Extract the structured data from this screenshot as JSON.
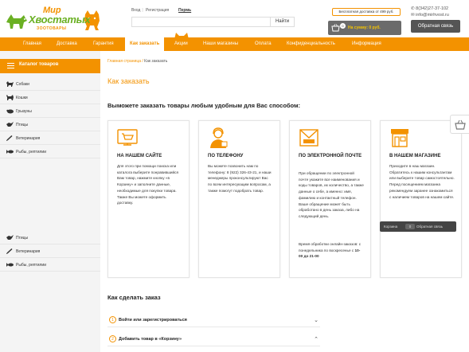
{
  "header": {
    "logo_line1": "Мир",
    "logo_line2": "Хвостатых",
    "logo_sub": "ЗООТОВАРЫ",
    "login_label": "Вход",
    "register_label": "Регистрация",
    "lang_label": "Пермь",
    "search_placeholder": "",
    "search_button": "Найти",
    "delivery_note": "Бесплатная доставка от 499 руб.",
    "cart_count": "0",
    "cart_sum": "На сумму: 0 руб.",
    "phone": "8(342)27-37-102",
    "email": "info@mirhvost.ru",
    "callback_button": "Обратная связь"
  },
  "nav": {
    "items": [
      "Главная",
      "Доставка",
      "Гарантия",
      "Как заказать",
      "Акции",
      "Наши магазины",
      "Оплата",
      "Конфиденциальность",
      "Информация"
    ],
    "active": "Как заказать"
  },
  "sidebar": {
    "catalog_title": "Каталог товаров",
    "items": [
      "Собаки",
      "Кошки",
      "Грызуны",
      "Птицы",
      "Ветеринария",
      "Рыбы, рептилии"
    ],
    "items_lower": [
      "Птицы",
      "Ветеринария",
      "Рыбы, рептилии"
    ]
  },
  "breadcrumb": {
    "home": "Главная страница",
    "sep": "/",
    "current": "Как заказать"
  },
  "main": {
    "title": "Как заказать",
    "subtitle": "Выможете заказать товары любым удобным для Вас способом:",
    "cards": [
      {
        "title": "НА НАШЕМ САЙТЕ",
        "text": "Для этого при помощи поиска или каталога выберите понравившийся Вам товар, нажмите кнопку «в Корзину» и заполните данные, необходимые для покупки товара. Также Вы можете оформить доставку."
      },
      {
        "title": "ПО ТЕЛЕФОНУ",
        "text": "Вы можете позвонить нам по телефону: 8 (922) 326-43-21, и наши менеджеры проконсультируют Вас по всем интересующим вопросам, а также помогут подобрать товар."
      },
      {
        "title": "ПО ЭЛЕКТРОННОЙ ПОЧТЕ",
        "text": "При обращении по электронной почте укажите все наименования и коды товаров, их количество, а также данные о себе, а именно: имя, фамилию и контактный телефон. Ваше обращение может быть обработано в день заказа, либо на следующий день.",
        "text2": "Время обработки онлайн-заказов: с понедельника по воскресенье с",
        "hours": "10-00 до 21-00"
      },
      {
        "title": "В НАШЕМ МАГАЗИНЕ",
        "text": "Приходите в наш магазин. Обратитесь к нашим консультантам или выберите товар самостоятельно. Перед посещением магазина рекомендуем заранее ознакомиться с наличием товаров на нашем сайте."
      }
    ],
    "how_title": "Как сделать заказ",
    "steps": [
      {
        "num": "1",
        "label": "Войти или зарегистрироваться"
      },
      {
        "num": "2",
        "label": "Добавить товар в «Корзину»"
      }
    ]
  },
  "cart_popup": {
    "label": "Корзина",
    "count": "0",
    "callback": "Обратная связь"
  },
  "colors": {
    "accent": "#f39200",
    "green": "#6ab023",
    "dark": "#555555"
  }
}
